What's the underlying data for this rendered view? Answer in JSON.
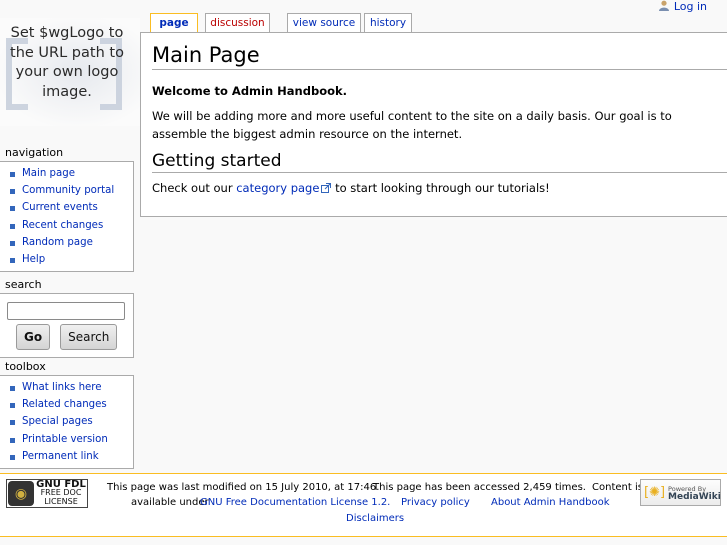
{
  "logo": {
    "placeholder_text": "Set $wgLogo to the URL path to your own logo image."
  },
  "user_tools": {
    "login": "Log in"
  },
  "tabs": [
    {
      "label": "page",
      "selected": true
    },
    {
      "label": "discussion",
      "new": true
    },
    {
      "label": "view source"
    },
    {
      "label": "history"
    }
  ],
  "content": {
    "title": "Main Page",
    "welcome": "Welcome to Admin Handbook.",
    "intro": "We will be adding more and more useful content to the site on a daily basis. Our goal is to assemble the biggest admin resource on the internet.",
    "section_heading": "Getting started",
    "checkout_prefix": "Check out our ",
    "checkout_link": "category page",
    "checkout_suffix": " to start looking through our tutorials!"
  },
  "navigation": {
    "heading": "navigation",
    "items": [
      "Main page",
      "Community portal",
      "Current events",
      "Recent changes",
      "Random page",
      "Help"
    ]
  },
  "search": {
    "heading": "search",
    "input_value": "",
    "go_label": "Go",
    "search_label": "Search"
  },
  "toolbox": {
    "heading": "toolbox",
    "items": [
      "What links here",
      "Related changes",
      "Special pages",
      "Printable version",
      "Permanent link"
    ]
  },
  "footer": {
    "gnu_badge": {
      "line1": "GNU FDL",
      "line2": "FREE DOC",
      "line3": "LICENSE"
    },
    "powered_badge": {
      "line1": "Powered By",
      "line2": "MediaWiki"
    },
    "last_modified": "This page was last modified on 15 July 2010, at 17:46.",
    "accessed": "This page has been accessed 2,459 times.",
    "content_is": "Content is",
    "available_under": "available under",
    "license_link": "GNU Free Documentation License 1.2.",
    "privacy": "Privacy policy",
    "about": "About Admin Handbook",
    "disclaimers": "Disclaimers"
  },
  "colors": {
    "link": "#002bb8",
    "new_link": "#ba0000",
    "accent": "#fabd23",
    "bullet": "#3366bb"
  }
}
